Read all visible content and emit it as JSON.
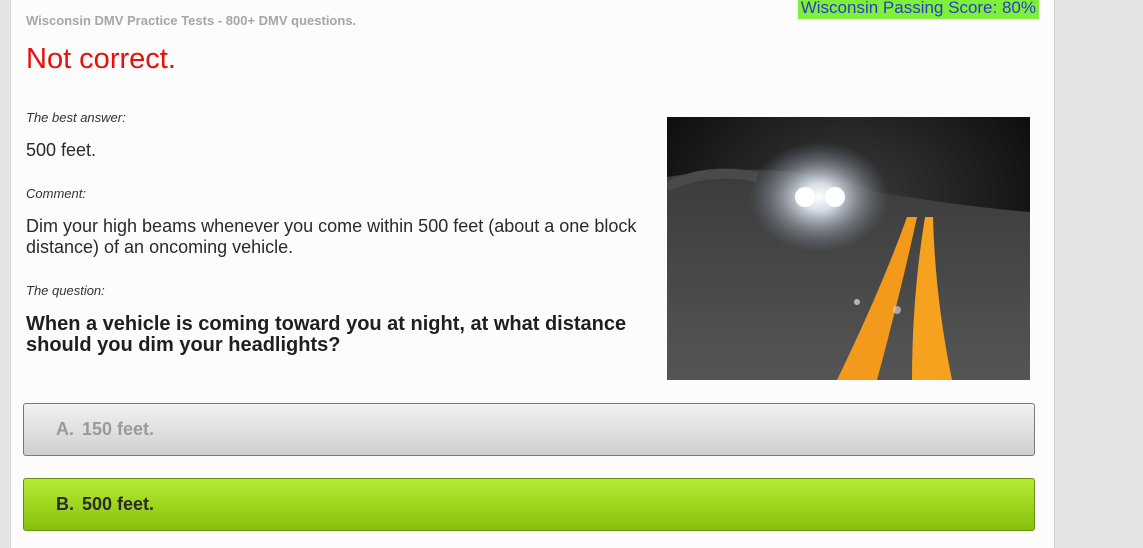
{
  "header": {
    "site_title": "Wisconsin DMV Practice Tests - 800+ DMV questions.",
    "passing_score": "Wisconsin Passing Score: 80%"
  },
  "result": {
    "status": "Not correct."
  },
  "best_answer": {
    "label": "The best answer:",
    "value": "500 feet."
  },
  "comment": {
    "label": "Comment:",
    "text": "Dim your high beams whenever you come within 500 feet (about a one block distance) of an oncoming vehicle."
  },
  "question": {
    "label": "The question:",
    "text": "When a vehicle is coming toward you at night, at what distance should you dim your headlights?"
  },
  "answers": [
    {
      "letter": "A.",
      "text": "150 feet."
    },
    {
      "letter": "B.",
      "text": "500 feet."
    }
  ],
  "colors": {
    "incorrect": "#e8100a",
    "passing_badge": "#7ef03c",
    "correct_answer": "#9ad21e"
  }
}
